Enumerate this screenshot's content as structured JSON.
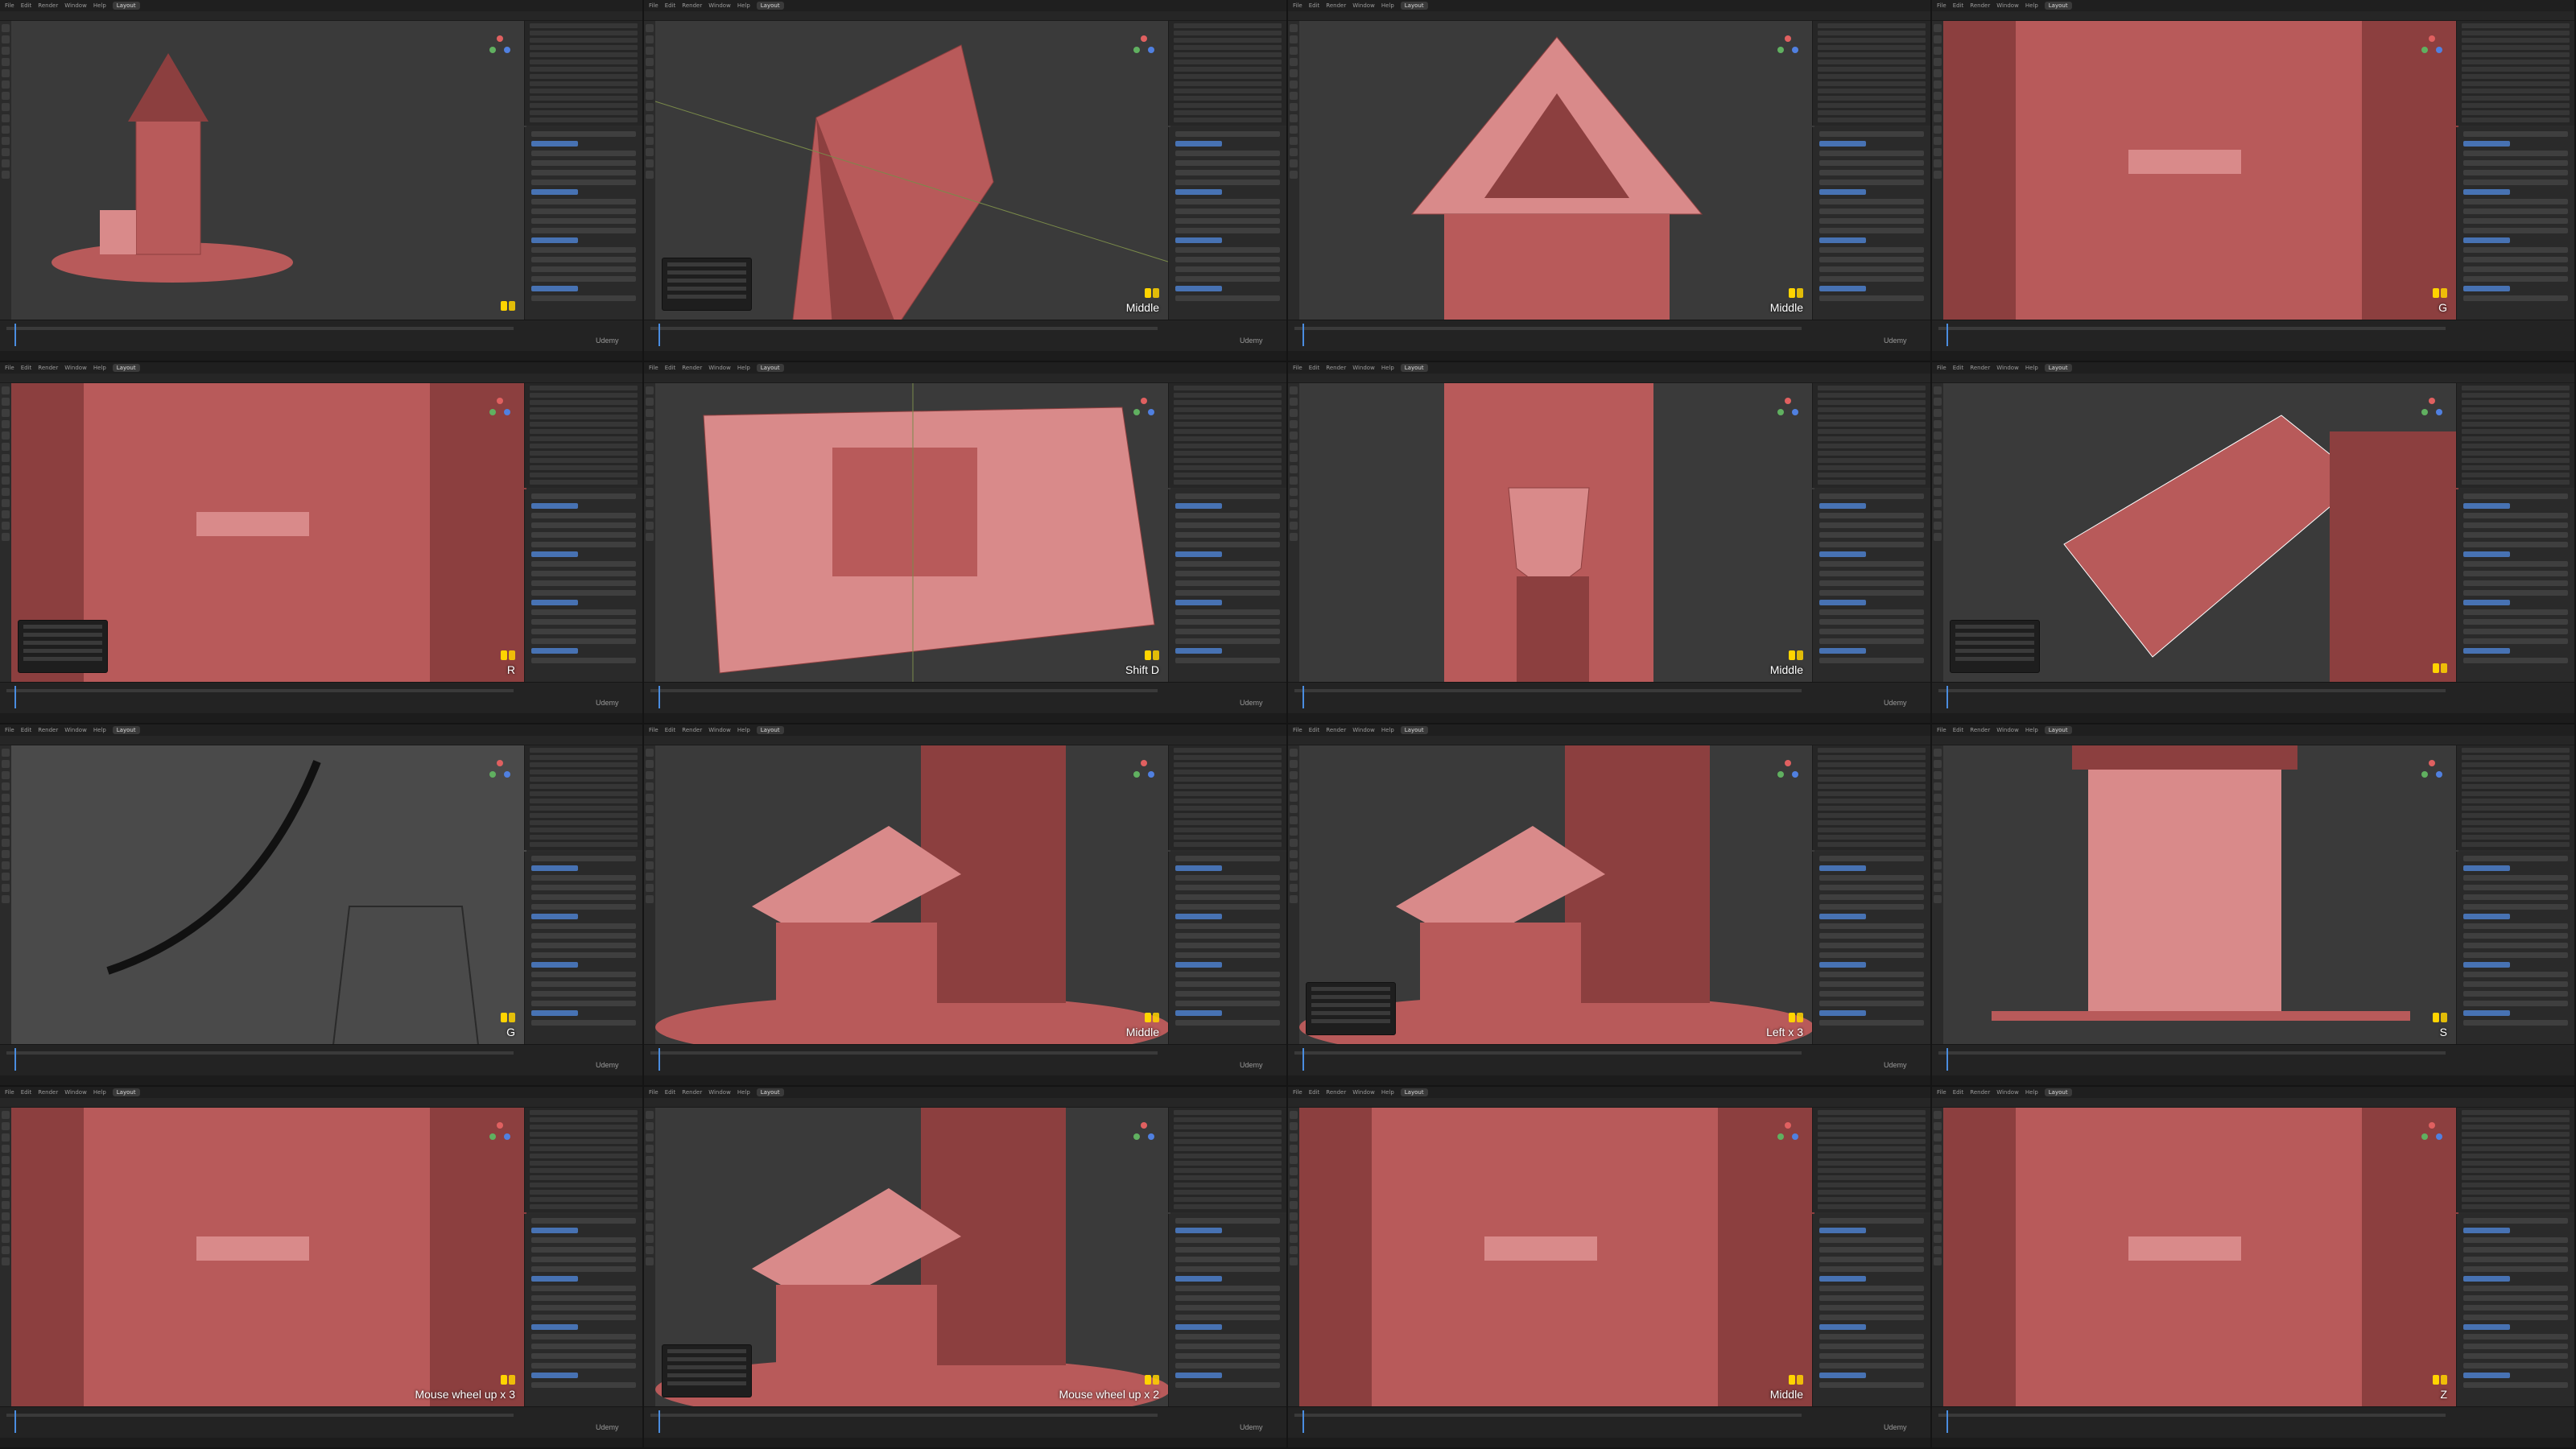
{
  "app": {
    "menu": [
      "File",
      "Edit",
      "Render",
      "Window",
      "Help"
    ],
    "active_workspace": "Layout",
    "accent_color": "#4772b3",
    "model_color": "#b85a5a",
    "viewport_bg": "#3a3a3a"
  },
  "watermark": "Udemy",
  "frames": [
    {
      "id": 1,
      "shot": "full-house-with-material-popup",
      "key": ""
    },
    {
      "id": 2,
      "shot": "roof-side-perspective",
      "key": "Middle"
    },
    {
      "id": 3,
      "shot": "roof-front-view",
      "key": "Middle"
    },
    {
      "id": 4,
      "shot": "wall-closeup-plank",
      "key": "G"
    },
    {
      "id": 5,
      "shot": "wall-closeup-small-planks",
      "key": "R"
    },
    {
      "id": 6,
      "shot": "top-down-base",
      "key": "Shift D"
    },
    {
      "id": 7,
      "shot": "door-shield-front",
      "key": "Middle"
    },
    {
      "id": 8,
      "shot": "awning-roof-edit",
      "key": ""
    },
    {
      "id": 9,
      "shot": "wireframe-curve-edit",
      "key": "G"
    },
    {
      "id": 10,
      "shot": "annex-roof-perspective",
      "key": "Middle"
    },
    {
      "id": 11,
      "shot": "annex-box-selected",
      "key": "Left x 3"
    },
    {
      "id": 12,
      "shot": "back-wall-scale",
      "key": "S"
    },
    {
      "id": 13,
      "shot": "side-wall-closeup",
      "key": "Mouse wheel up x 3"
    },
    {
      "id": 14,
      "shot": "annex-perspective-zoom",
      "key": "Mouse wheel up x 2"
    },
    {
      "id": 15,
      "shot": "pillar-front-closeup",
      "key": "Middle"
    },
    {
      "id": 16,
      "shot": "wall-with-menu",
      "key": "Z"
    }
  ]
}
